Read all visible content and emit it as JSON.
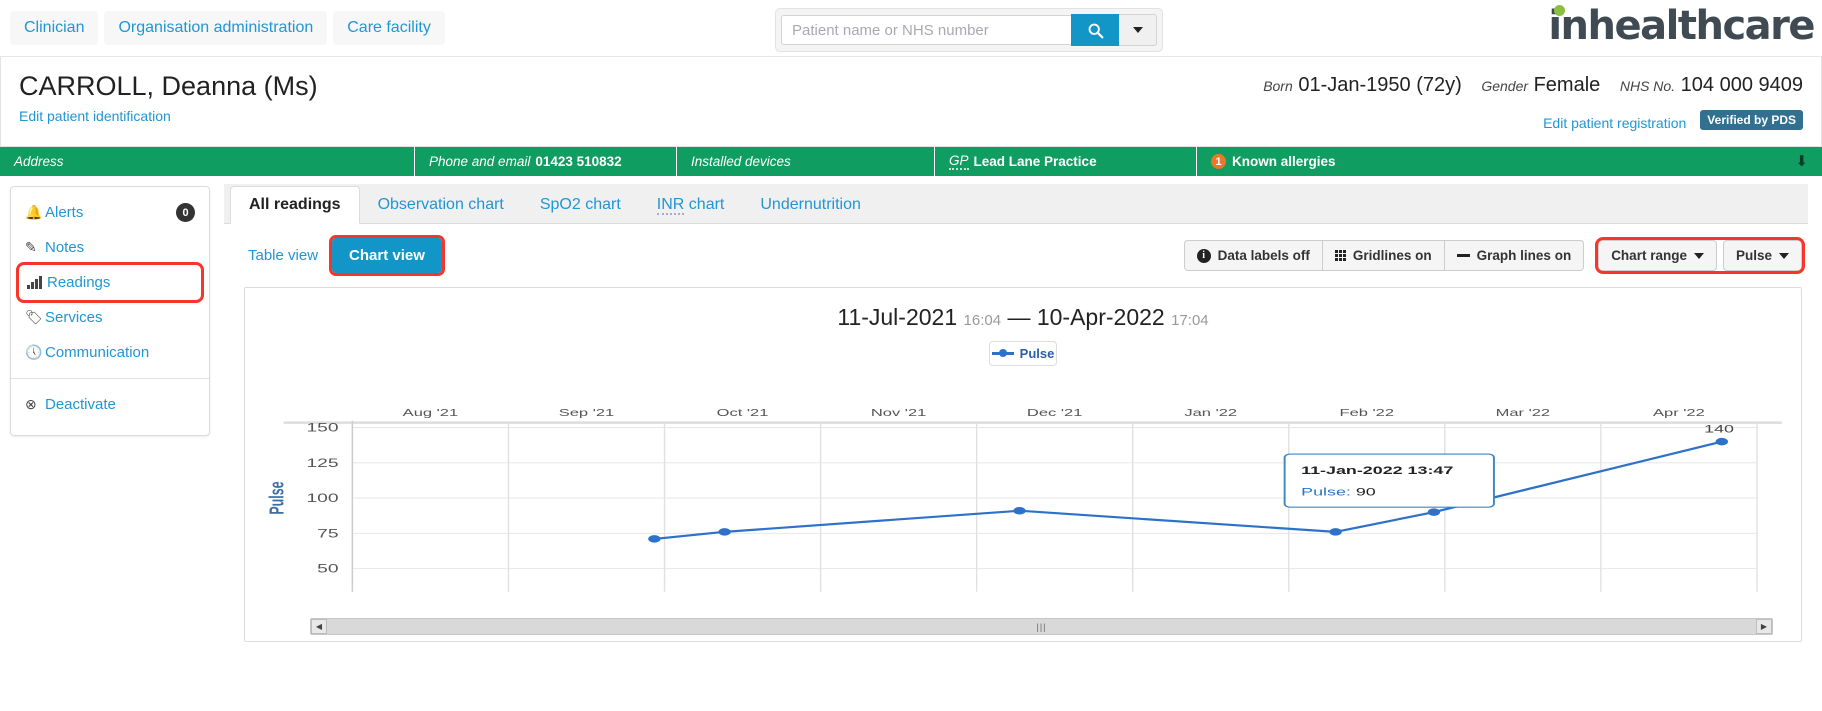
{
  "topnav": {
    "items": [
      {
        "label": "Clinician"
      },
      {
        "label": "Organisation administration"
      },
      {
        "label": "Care facility"
      }
    ]
  },
  "search": {
    "placeholder": "Patient name or NHS number",
    "value": "",
    "search_icon": "search-icon",
    "dropdown_icon": "chevron-down-icon"
  },
  "brand": {
    "name": "inhealthcare",
    "dot_color": "#8cbf3f",
    "text_color": "#3f4a52"
  },
  "patient": {
    "name": "CARROLL, Deanna (Ms)",
    "edit_identification": "Edit patient identification",
    "born_label": "Born",
    "born_value": "01-Jan-1950 (72y)",
    "gender_label": "Gender",
    "gender_value": "Female",
    "nhs_label": "NHS No.",
    "nhs_value": "104 000 9409",
    "edit_registration": "Edit patient registration",
    "verified_badge": "Verified by PDS"
  },
  "greenbar": {
    "address": "Address",
    "phone_label": "Phone and email",
    "phone_value": "01423 510832",
    "installed_devices": "Installed devices",
    "gp_label": "GP",
    "gp_value": "Lead Lane Practice",
    "allergies_count": "1",
    "allergies_label": "Known allergies",
    "expand_icon": "down-arrow-icon"
  },
  "sidebar": {
    "items": [
      {
        "label": "Alerts",
        "icon": "bell-icon",
        "badge": "0"
      },
      {
        "label": "Notes",
        "icon": "edit-note-icon"
      },
      {
        "label": "Readings",
        "icon": "bar-chart-icon",
        "highlighted": true
      },
      {
        "label": "Services",
        "icon": "tag-icon"
      },
      {
        "label": "Communication",
        "icon": "clock-icon"
      },
      {
        "label": "Deactivate",
        "icon": "circle-x-icon"
      }
    ]
  },
  "tabs": [
    {
      "label": "All readings",
      "active": true
    },
    {
      "label": "Observation chart",
      "active": false
    },
    {
      "label": "SpO2 chart",
      "active": false
    },
    {
      "label": "INR chart",
      "active": false,
      "abbrev": "INR"
    },
    {
      "label": "Undernutrition",
      "active": false
    }
  ],
  "toolbar": {
    "table_view": "Table view",
    "chart_view": "Chart view",
    "data_labels": "Data labels off",
    "gridlines": "Gridlines on",
    "graph_lines": "Graph lines on",
    "chart_range": "Chart range",
    "series_select": "Pulse",
    "info_icon": "info-icon",
    "grid_icon": "grid-icon",
    "line_icon": "line-icon",
    "accent_color": "#1296c8",
    "highlight_color": "#f9342a"
  },
  "chart_panel": {
    "start_date": "11-Jul-2021",
    "start_time": "16:04",
    "separator": "—",
    "end_date": "10-Apr-2022",
    "end_time": "17:04",
    "legend_label": "Pulse",
    "scroll_left_icon": "chevron-left-icon",
    "scroll_right_icon": "chevron-right-icon"
  },
  "chart_data": {
    "type": "line",
    "title": "11-Jul-2021 16:04 — 10-Apr-2022 17:04",
    "xlabel": "",
    "ylabel": "Pulse",
    "ylim": [
      50,
      150
    ],
    "yticks": [
      50,
      75,
      100,
      125,
      150
    ],
    "xticks": [
      "Aug '21",
      "Sep '21",
      "Oct '21",
      "Nov '21",
      "Dec '21",
      "Jan '22",
      "Feb '22",
      "Mar '22",
      "Apr '22"
    ],
    "grid": true,
    "legend": [
      "Pulse"
    ],
    "legend_position": "top-center",
    "series": [
      {
        "name": "Pulse",
        "color": "#2d72c8",
        "points": [
          {
            "x": "Sep '21",
            "x_frac": 0.215,
            "y": 71,
            "label": ""
          },
          {
            "x": "Sep '21",
            "x_frac": 0.265,
            "y": 76,
            "label": ""
          },
          {
            "x": "Nov '21",
            "x_frac": 0.475,
            "y": 91,
            "label": ""
          },
          {
            "x": "Jan '22",
            "x_frac": 0.7,
            "y": 76,
            "label": ""
          },
          {
            "x": "Jan '22",
            "x_frac": 0.77,
            "y": 90,
            "label": "90"
          },
          {
            "x": "Mar '22",
            "x_frac": 0.975,
            "y": 140,
            "label": "140"
          }
        ]
      }
    ],
    "tooltip": {
      "visible": true,
      "datetime": "11-Jan-2022 13:47",
      "series_label": "Pulse:",
      "value": "90"
    }
  }
}
